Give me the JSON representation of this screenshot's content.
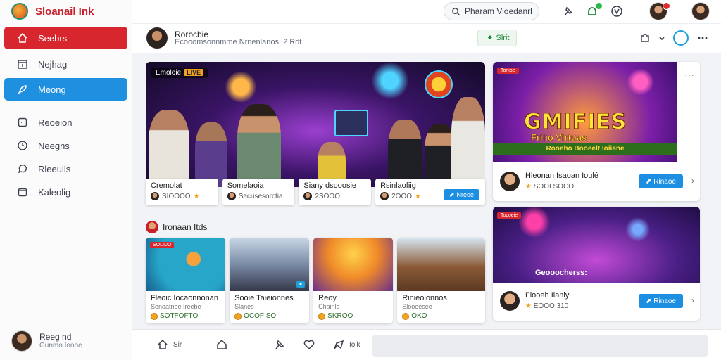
{
  "app": {
    "name": "Sloanail Ink"
  },
  "sidebar": {
    "items": [
      {
        "label": "Seebrs",
        "icon": "home-icon"
      },
      {
        "label": "Nejhag",
        "icon": "calendar-icon"
      },
      {
        "label": "Meong",
        "icon": "rocket-icon"
      },
      {
        "label": "Reoeion",
        "icon": "square-icon"
      },
      {
        "label": "Neegns",
        "icon": "globe-icon"
      },
      {
        "label": "Rleeuils",
        "icon": "chat-icon"
      },
      {
        "label": "Kaleolig",
        "icon": "folder-icon"
      }
    ],
    "profile": {
      "name": "Reeg nd",
      "sub": "Gunmo Ioooe"
    }
  },
  "topbar": {
    "search_label": "Pharam Vioedanrl"
  },
  "pagehead": {
    "title": "Rorbcbie",
    "subtitle": "Ecooomsonnmme Nrnenlanos, 2 Rdt",
    "start_label": "Slrit"
  },
  "hero": {
    "tag": "Emoloie",
    "tag_badge": "LIVE",
    "cards": [
      {
        "title": "Cremolat",
        "meta": "SIOOOO"
      },
      {
        "title": "Somelaoia",
        "meta": "Sacusesorctia"
      },
      {
        "title": "Siany dsooosie",
        "meta": "2SOOO"
      },
      {
        "title": "Rsinlaofiig",
        "meta": "2OOO",
        "button": "Nreoe"
      }
    ]
  },
  "section": {
    "title": "Ironaan Itds",
    "cards": [
      {
        "title": "Fleoic Iocaonnonan",
        "sub": "Senoatnoe Ireebe",
        "meta": "SOTFOFTO",
        "tag": "SOLIDO"
      },
      {
        "title": "Sooie Taieionnes",
        "sub": "Slanes",
        "meta": "OCOF SO"
      },
      {
        "title": "Reoy",
        "sub": "Chainle",
        "meta": "SKROO"
      },
      {
        "title": "Rinieolonnos",
        "sub": "Slooeesee",
        "meta": "OKO"
      }
    ]
  },
  "right": {
    "card1": {
      "tag": "Tonibe",
      "promo": "GMIFIES",
      "promo_sub": "Frilio Virtuas",
      "banner": "Rooeho Booeelt Ioiiane",
      "title": "Hleonan Isaoan Ioulé",
      "meta": "SOOI SOCO",
      "button": "Rinaoe"
    },
    "card2": {
      "tag": "Tocoeie",
      "caption": "Geooocherss:",
      "title": "Flooeh Ilaniy",
      "meta": "EOOO 310",
      "button": "Rinaoe"
    }
  },
  "bottombar": {
    "home_label": "Sir",
    "share_label": "Iolk"
  },
  "colors": {
    "brand_red": "#d8262e",
    "accent_blue": "#1f8fe0",
    "accent_green": "#1b8a3a"
  }
}
